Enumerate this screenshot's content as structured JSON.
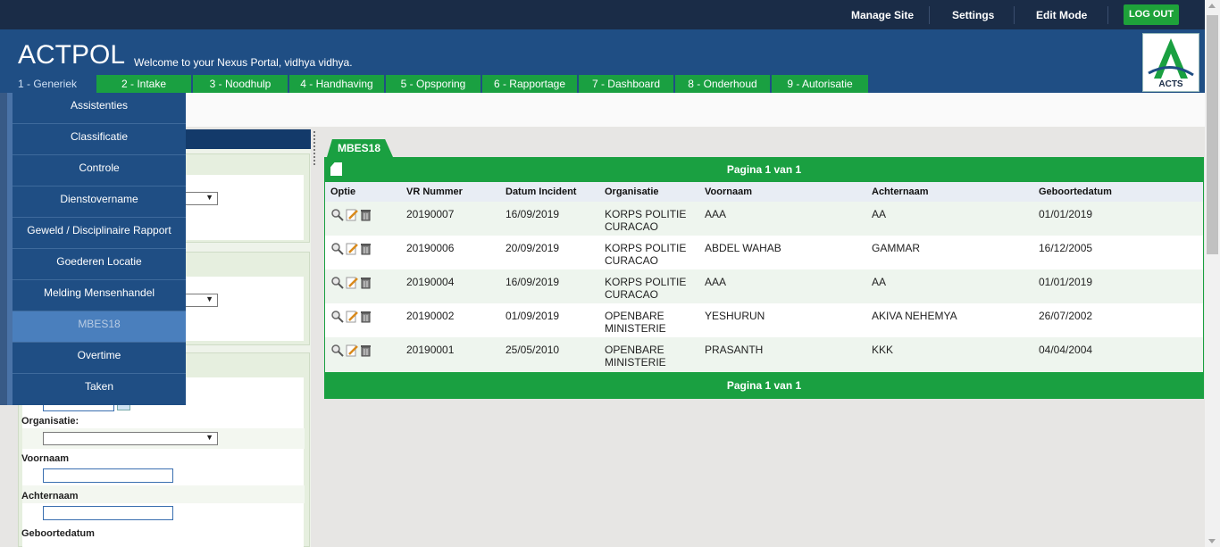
{
  "topbar": {
    "manage_site": "Manage Site",
    "settings": "Settings",
    "edit_mode": "Edit Mode",
    "logout": "LOG OUT"
  },
  "header": {
    "app_title": "ACTPOL",
    "welcome": "Welcome to your Nexus Portal, vidhya vidhya.",
    "logo_text": "ACTS"
  },
  "tabs": [
    {
      "label": "1 - Generiek"
    },
    {
      "label": "2 - Intake"
    },
    {
      "label": "3 - Noodhulp"
    },
    {
      "label": "4 - Handhaving"
    },
    {
      "label": "5 - Opsporing"
    },
    {
      "label": "6 - Rapportage"
    },
    {
      "label": "7 - Dashboard"
    },
    {
      "label": "8 - Onderhoud"
    },
    {
      "label": "9 - Autorisatie"
    }
  ],
  "menu": {
    "items": [
      {
        "label": "Assistenties"
      },
      {
        "label": "Classificatie"
      },
      {
        "label": "Controle"
      },
      {
        "label": "Dienstovername"
      },
      {
        "label": "Geweld / Disciplinaire Rapport"
      },
      {
        "label": "Goederen Locatie"
      },
      {
        "label": "Melding Mensenhandel"
      },
      {
        "label": "MBES18"
      },
      {
        "label": "Overtime"
      },
      {
        "label": "Taken"
      }
    ],
    "active_item": "MBES18"
  },
  "search_form": {
    "organisatie_label": "Organisatie:",
    "voornaam_label": "Voornaam",
    "achternaam_label": "Achternaam",
    "geboortedatum_label": "Geboortedatum"
  },
  "grid": {
    "tab_title": "MBES18",
    "pager_top": "Pagina 1 van 1",
    "pager_bottom": "Pagina 1 van 1",
    "columns": [
      "Optie",
      "VR Nummer",
      "Datum Incident",
      "Organisatie",
      "Voornaam",
      "Achternaam",
      "Geboortedatum"
    ],
    "rows": [
      {
        "vr": "20190007",
        "datum": "16/09/2019",
        "org1": "KORPS POLITIE",
        "org2": "CURACAO",
        "voornaam": "AAA",
        "achternaam": "AA",
        "geboorte": "01/01/2019"
      },
      {
        "vr": "20190006",
        "datum": "20/09/2019",
        "org1": "KORPS POLITIE",
        "org2": "CURACAO",
        "voornaam": "ABDEL WAHAB",
        "achternaam": "GAMMAR",
        "geboorte": "16/12/2005"
      },
      {
        "vr": "20190004",
        "datum": "16/09/2019",
        "org1": "KORPS POLITIE",
        "org2": "CURACAO",
        "voornaam": "AAA",
        "achternaam": "AA",
        "geboorte": "01/01/2019"
      },
      {
        "vr": "20190002",
        "datum": "01/09/2019",
        "org1": "OPENBARE",
        "org2": "MINISTERIE",
        "voornaam": "YESHURUN",
        "achternaam": "AKIVA NEHEMYA",
        "geboorte": "26/07/2002"
      },
      {
        "vr": "20190001",
        "datum": "25/05/2010",
        "org1": "OPENBARE",
        "org2": "MINISTERIE",
        "voornaam": "PRASANTH",
        "achternaam": "KKK",
        "geboorte": "04/04/2004"
      }
    ]
  },
  "colors": {
    "top_bar": "#1a2c47",
    "header_blue": "#1f4e84",
    "accent_green": "#1aa041",
    "menu_active": "#4a7fbd"
  }
}
